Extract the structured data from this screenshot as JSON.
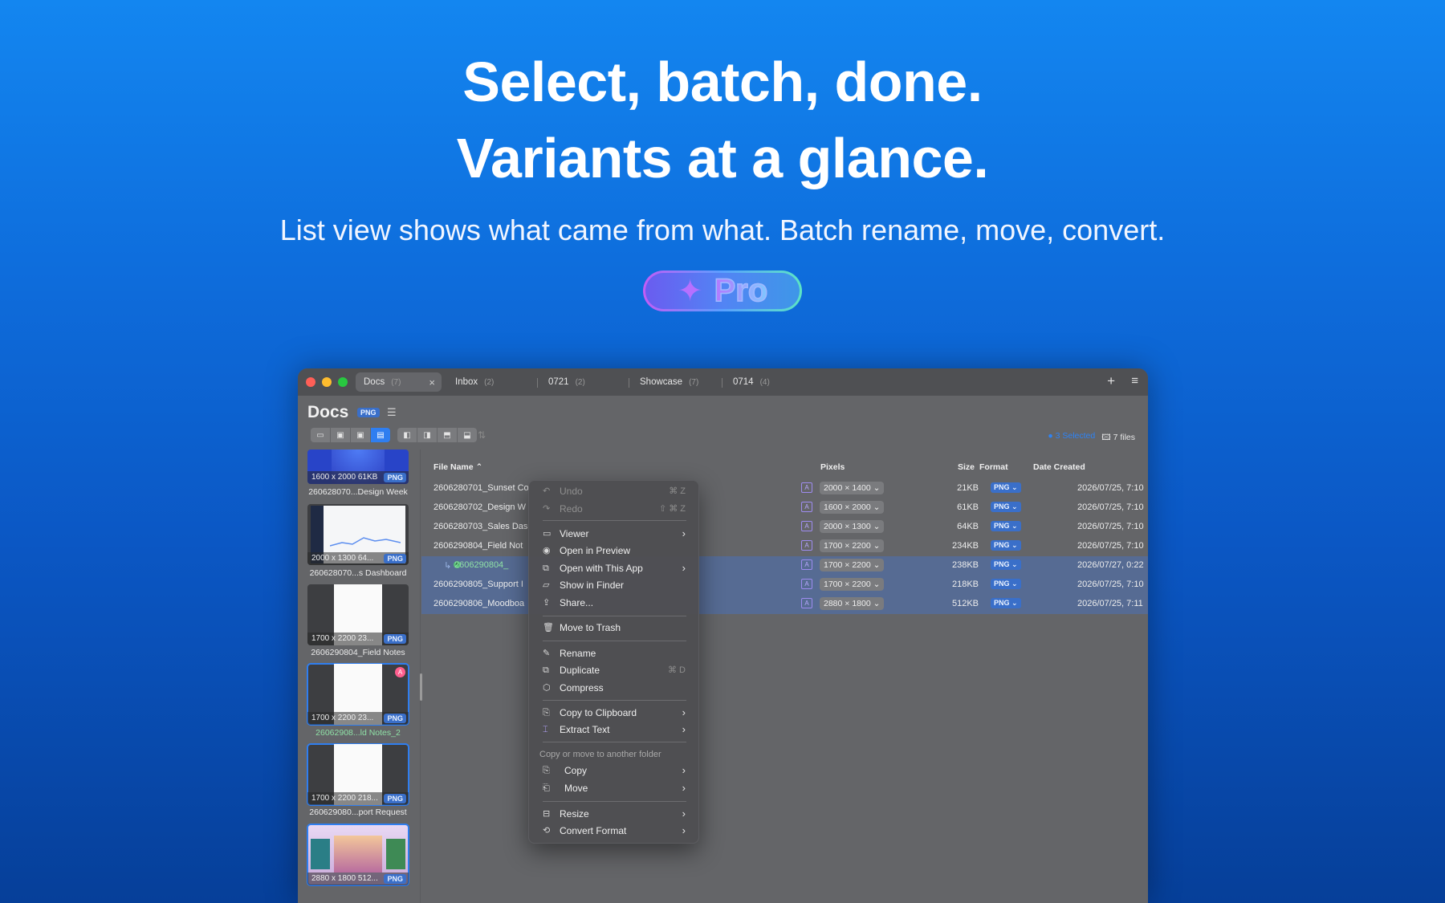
{
  "hero": {
    "headline_1": "Select, batch, done.",
    "headline_2": "Variants at a glance.",
    "subtitle": "List view shows what came from what. Batch rename, move, convert.",
    "pro_label": "Pro",
    "sparkle_icon": "sparkles-icon"
  },
  "window": {
    "tabs": [
      {
        "label": "Docs",
        "count": "(7)"
      },
      {
        "label": "Inbox",
        "count": "(2)"
      },
      {
        "label": "0721",
        "count": "(2)"
      },
      {
        "label": "Showcase",
        "count": "(7)"
      },
      {
        "label": "0714",
        "count": "(4)"
      }
    ],
    "title": "Docs",
    "title_format": "PNG",
    "selection_text": "3 Selected",
    "file_count": "7 files",
    "columns": {
      "file_name": "File Name ⌃",
      "pixels": "Pixels",
      "size": "Size",
      "format": "Format",
      "date_created": "Date Created"
    },
    "rows": [
      {
        "name": "2606280701_Sunset Co",
        "pixels": "2000 × 1400 ⌄",
        "size": "21KB",
        "format": "PNG ⌄",
        "date": "2026/07/25, 7:10"
      },
      {
        "name": "2606280702_Design W",
        "pixels": "1600 × 2000 ⌄",
        "size": "61KB",
        "format": "PNG ⌄",
        "date": "2026/07/25, 7:10"
      },
      {
        "name": "2606280703_Sales Das",
        "pixels": "2000 × 1300 ⌄",
        "size": "64KB",
        "format": "PNG ⌄",
        "date": "2026/07/25, 7:10"
      },
      {
        "name": "2606290804_Field Not",
        "pixels": "1700 × 2200 ⌄",
        "size": "234KB",
        "format": "PNG ⌄",
        "date": "2026/07/25, 7:10"
      },
      {
        "name": "2606290804_",
        "pixels": "1700 × 2200 ⌄",
        "size": "238KB",
        "format": "PNG ⌄",
        "date": "2026/07/27, 0:22"
      },
      {
        "name": "2606290805_Support I",
        "pixels": "1700 × 2200 ⌄",
        "size": "218KB",
        "format": "PNG ⌄",
        "date": "2026/07/25, 7:10"
      },
      {
        "name": "2606290806_Moodboa",
        "pixels": "2880 × 1800 ⌄",
        "size": "512KB",
        "format": "PNG ⌄",
        "date": "2026/07/25, 7:11"
      }
    ],
    "thumbs": [
      {
        "meta": "1600 x 2000  61KB",
        "format": "PNG",
        "label": "260628070...Design Week"
      },
      {
        "meta": "2000 x 1300  64...",
        "format": "PNG",
        "label": "260628070...s Dashboard"
      },
      {
        "meta": "1700 x 2200  23...",
        "format": "PNG",
        "label": "2606290804_Field Notes"
      },
      {
        "meta": "1700 x 2200  23...",
        "format": "PNG",
        "label": "26062908...ld Notes_2"
      },
      {
        "meta": "1700 x 2200  218...",
        "format": "PNG",
        "label": "260629080...port Request"
      },
      {
        "meta": "2880 x 1800  512...",
        "format": "PNG",
        "label": ""
      }
    ],
    "context_menu": {
      "undo": "Undo",
      "undo_sc": "⌘ Z",
      "redo": "Redo",
      "redo_sc": "⇧ ⌘ Z",
      "viewer": "Viewer",
      "open_preview": "Open in Preview",
      "open_with_app": "Open with This App",
      "show_in_finder": "Show in Finder",
      "share": "Share...",
      "move_to_trash": "Move to Trash",
      "rename": "Rename",
      "duplicate": "Duplicate",
      "duplicate_sc": "⌘ D",
      "compress": "Compress",
      "copy_clipboard": "Copy to Clipboard",
      "extract_text": "Extract Text",
      "copy_move_header": "Copy or move to another folder",
      "copy": "Copy",
      "move": "Move",
      "resize": "Resize",
      "convert_format": "Convert Format"
    }
  }
}
